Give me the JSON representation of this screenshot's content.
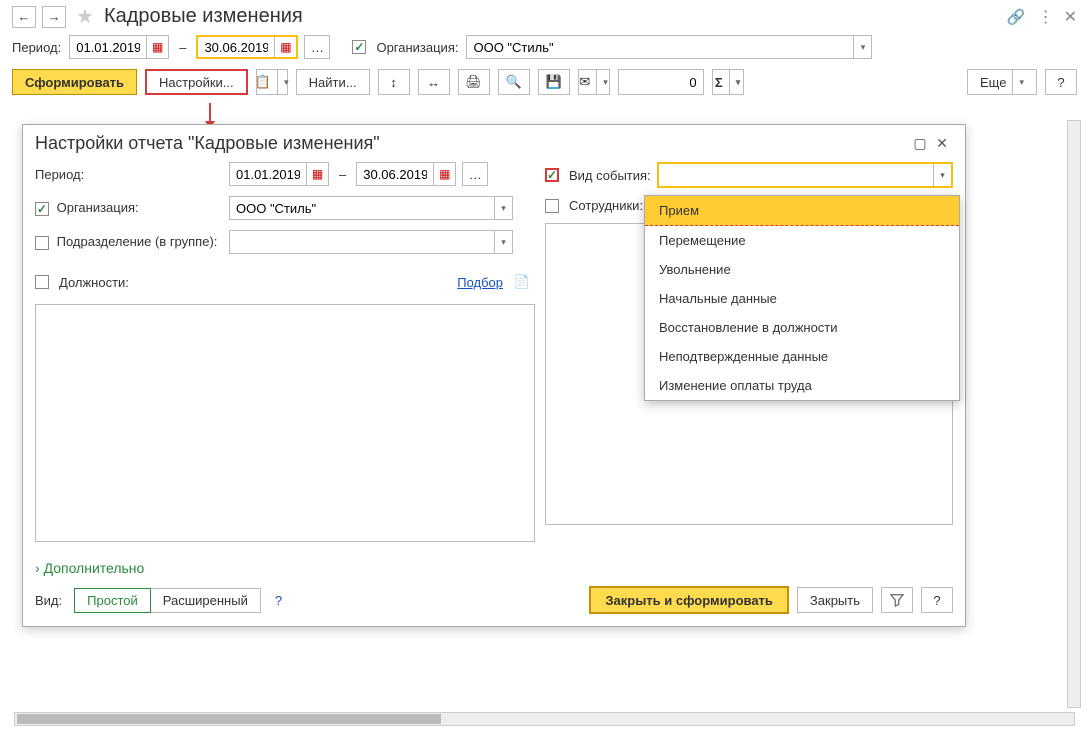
{
  "header": {
    "title": "Кадровые изменения"
  },
  "filters": {
    "period_label": "Период:",
    "date_from": "01.01.2019",
    "date_to": "30.06.2019",
    "org_label": "Организация:",
    "org_value": "ООО \"Стиль\""
  },
  "toolbar": {
    "generate": "Сформировать",
    "settings": "Настройки...",
    "find": "Найти...",
    "number_value": "0",
    "more": "Еще",
    "help": "?"
  },
  "modal": {
    "title": "Настройки отчета \"Кадровые изменения\"",
    "period_label": "Период:",
    "date_from": "01.01.2019",
    "date_to": "30.06.2019",
    "org_label": "Организация:",
    "org_value": "ООО \"Стиль\"",
    "dept_label": "Подразделение (в группе):",
    "positions_label": "Должности:",
    "pick_link": "Подбор",
    "event_label": "Вид события:",
    "employees_label": "Сотрудники:",
    "more_link": "Дополнительно",
    "view_label": "Вид:",
    "mode_simple": "Простой",
    "mode_advanced": "Расширенный",
    "close_generate": "Закрыть и сформировать",
    "close": "Закрыть",
    "help": "?"
  },
  "event_options": [
    "Прием",
    "Перемещение",
    "Увольнение",
    "Начальные данные",
    "Восстановление в должности",
    "Неподтвержденные данные",
    "Изменение оплаты труда"
  ]
}
